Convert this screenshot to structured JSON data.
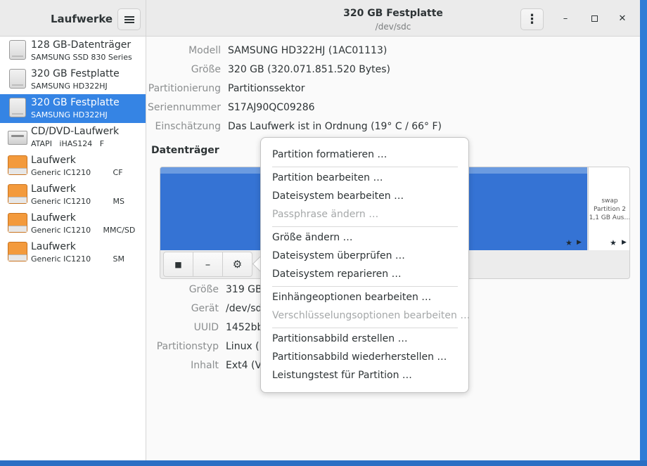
{
  "sidebar_header": {
    "title": "Laufwerke",
    "menu_icon": "hamburger-icon"
  },
  "window_header": {
    "title": "320 GB Festplatte",
    "subtitle": "/dev/sdc"
  },
  "window_controls": {
    "menu": "⋮",
    "minimize": "–",
    "maximize": "□",
    "close": "✕"
  },
  "devices": [
    {
      "name": "128 GB-Datenträger",
      "sub": "SAMSUNG SSD 830 Series",
      "icon": "hard-disk-icon",
      "selected": false
    },
    {
      "name": "320 GB Festplatte",
      "sub": "SAMSUNG HD322HJ",
      "icon": "hard-disk-icon",
      "selected": false
    },
    {
      "name": "320 GB Festplatte",
      "sub": "SAMSUNG HD322HJ",
      "icon": "hard-disk-icon",
      "selected": true
    },
    {
      "name": "CD/DVD-Laufwerk",
      "sub": "ATAPI   iHAS124   F",
      "icon": "optical-drive-icon",
      "selected": false
    },
    {
      "name": "Laufwerk",
      "sub": "Generic IC1210         CF",
      "icon": "memory-card-icon",
      "selected": false
    },
    {
      "name": "Laufwerk",
      "sub": "Generic IC1210         MS",
      "icon": "memory-card-icon",
      "selected": false
    },
    {
      "name": "Laufwerk",
      "sub": "Generic IC1210     MMC/SD",
      "icon": "memory-card-icon",
      "selected": false
    },
    {
      "name": "Laufwerk",
      "sub": "Generic IC1210         SM",
      "icon": "memory-card-icon",
      "selected": false
    }
  ],
  "drive_info": [
    {
      "label": "Modell",
      "value": "SAMSUNG HD322HJ (1AC01113)"
    },
    {
      "label": "Größe",
      "value": "320 GB (320.071.851.520 Bytes)"
    },
    {
      "label": "Partitionierung",
      "value": "Partitionssektor"
    },
    {
      "label": "Seriennummer",
      "value": "S17AJ90QC09286"
    },
    {
      "label": "Einschätzung",
      "value": "Das Laufwerk ist in Ordnung (19° C / 66° F)"
    }
  ],
  "volumes_title": "Datenträger",
  "swap_partition": {
    "line1": "swap",
    "line2": "Partition 2",
    "line3": "1,1 GB Aus…"
  },
  "volume_toolbar": {
    "stop": "■",
    "remove": "–",
    "settings": "⚙"
  },
  "partition_info": [
    {
      "label": "Größe",
      "value": "319 GB"
    },
    {
      "label": "Gerät",
      "value": "/dev/sd"
    },
    {
      "label": "UUID",
      "value": "1452bb"
    },
    {
      "label": "Partitionstyp",
      "value": "Linux ( E"
    },
    {
      "label": "Inhalt",
      "value": "Ext4 (Ve"
    }
  ],
  "context_menu": {
    "groups": [
      [
        {
          "label": "Partition formatieren …",
          "enabled": true
        }
      ],
      [
        {
          "label": "Partition bearbeiten …",
          "enabled": true
        },
        {
          "label": "Dateisystem bearbeiten …",
          "enabled": true
        },
        {
          "label": "Passphrase ändern …",
          "enabled": false
        }
      ],
      [
        {
          "label": "Größe ändern …",
          "enabled": true
        },
        {
          "label": "Dateisystem überprüfen …",
          "enabled": true
        },
        {
          "label": "Dateisystem reparieren …",
          "enabled": true
        }
      ],
      [
        {
          "label": "Einhängeoptionen bearbeiten …",
          "enabled": true
        },
        {
          "label": "Verschlüsselungsoptionen bearbeiten …",
          "enabled": false
        }
      ],
      [
        {
          "label": "Partitionsabbild erstellen …",
          "enabled": true
        },
        {
          "label": "Partitionsabbild wiederherstellen …",
          "enabled": true
        },
        {
          "label": "Leistungstest für Partition …",
          "enabled": true
        }
      ]
    ]
  },
  "colors": {
    "selection": "#3584e4",
    "volume": "#3573d4",
    "card": "#f39a3c"
  }
}
